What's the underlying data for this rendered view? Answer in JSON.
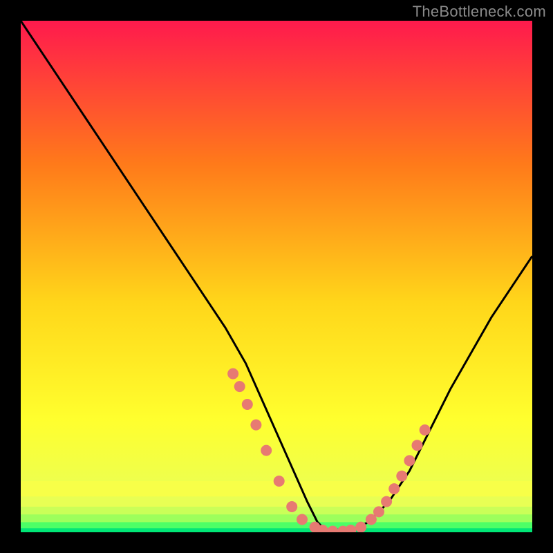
{
  "watermark": "TheBottleneck.com",
  "colors": {
    "bg": "#000000",
    "grad_top": "#ff1a4d",
    "grad_mid1": "#ff7a1a",
    "grad_mid2": "#ffd61a",
    "grad_mid3": "#ffff2e",
    "grad_low": "#e0ff66",
    "grad_green": "#00e676",
    "curve": "#000000",
    "dots": "#e77a72"
  },
  "chart_data": {
    "type": "line",
    "title": "",
    "xlabel": "",
    "ylabel": "",
    "xlim": [
      0,
      100
    ],
    "ylim": [
      0,
      100
    ],
    "series": [
      {
        "name": "bottleneck-curve",
        "x": [
          0,
          8,
          16,
          24,
          32,
          40,
          44,
          48,
          52,
          56,
          58,
          60,
          62,
          64,
          68,
          72,
          76,
          80,
          84,
          88,
          92,
          96,
          100
        ],
        "y": [
          100,
          88,
          76,
          64,
          52,
          40,
          33,
          24,
          15,
          6,
          2,
          0,
          0,
          0,
          2,
          6,
          12,
          20,
          28,
          35,
          42,
          48,
          54
        ]
      }
    ],
    "markers": {
      "name": "highlight-dots",
      "x": [
        41.5,
        42.8,
        44.3,
        46.0,
        48.0,
        50.5,
        53.0,
        55.0,
        57.5,
        59.0,
        61.0,
        63.0,
        64.5,
        66.5,
        68.5,
        70.0,
        71.5,
        73.0,
        74.5,
        76.0,
        77.5,
        79.0
      ],
      "y": [
        31.0,
        28.5,
        25.0,
        21.0,
        16.0,
        10.0,
        5.0,
        2.5,
        1.0,
        0.4,
        0.2,
        0.2,
        0.4,
        1.0,
        2.5,
        4.0,
        6.0,
        8.5,
        11.0,
        14.0,
        17.0,
        20.0
      ]
    },
    "gradient_bands": [
      {
        "y": 100,
        "color": "#00e676"
      },
      {
        "y": 99.0,
        "color": "#5dff66"
      },
      {
        "y": 97.5,
        "color": "#b3ff5a"
      },
      {
        "y": 95.5,
        "color": "#d9ff55"
      },
      {
        "y": 93.0,
        "color": "#f3ff52"
      },
      {
        "y": 90.0,
        "color": "#ffff3a"
      }
    ]
  }
}
